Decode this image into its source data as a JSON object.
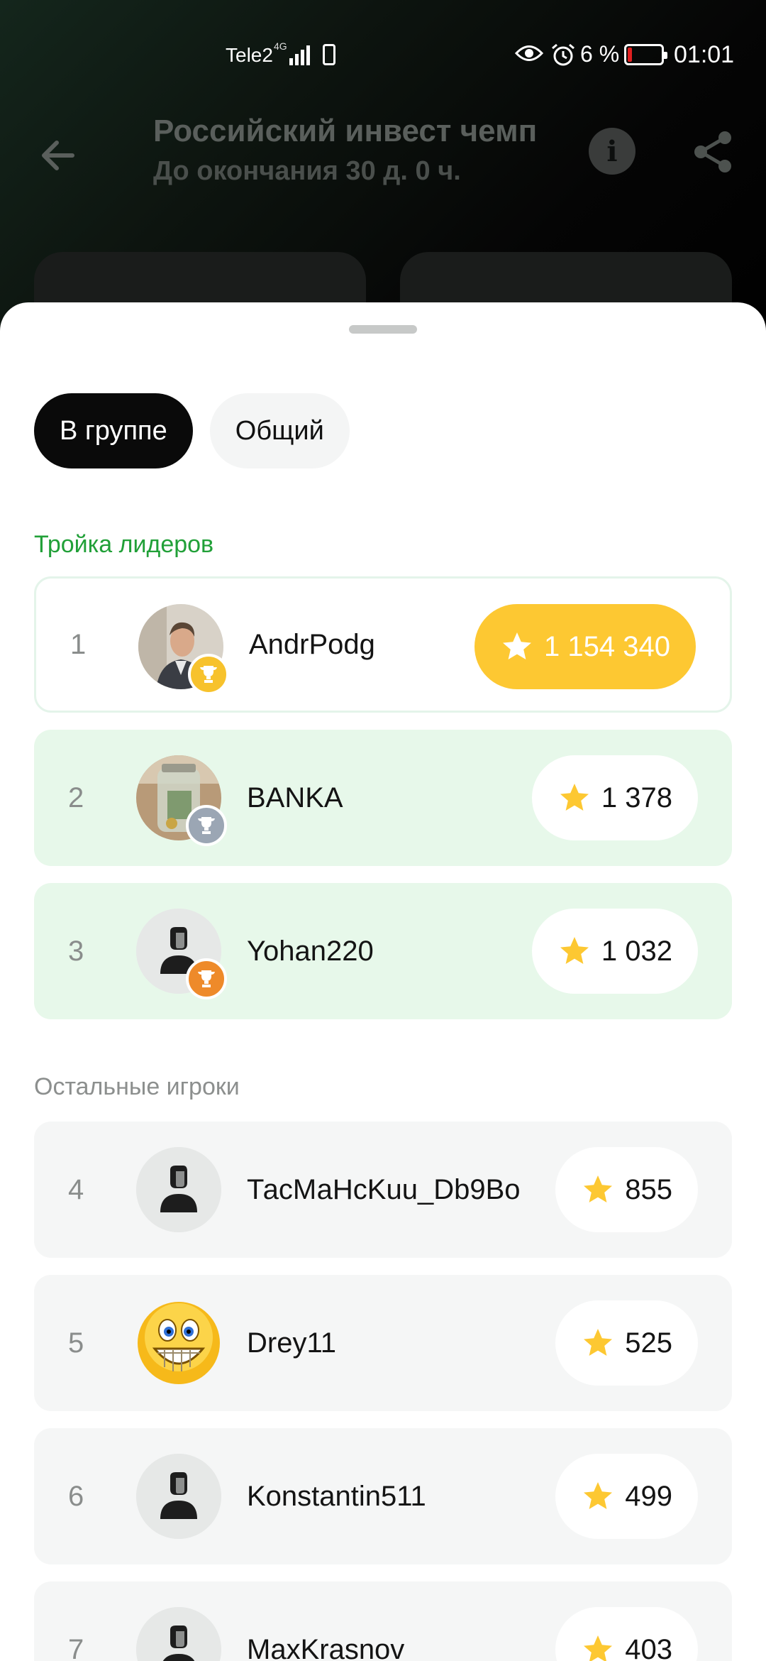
{
  "status_bar": {
    "carrier": "Tele2",
    "network": "4G",
    "battery_percent": "6 %",
    "time": "01:01",
    "icons": [
      "signal-icon",
      "phone-icon",
      "eye-icon",
      "alarm-icon",
      "battery-icon"
    ]
  },
  "header": {
    "title": "Российский инвест чемп",
    "subtitle": "До окончания 30 д. 0 ч.",
    "back_icon": "arrow-left-icon",
    "info_label": "i",
    "share_icon": "share-icon"
  },
  "tabs": [
    {
      "label": "В группе",
      "active": true
    },
    {
      "label": "Общий",
      "active": false
    }
  ],
  "leaders_label": "Тройка лидеров",
  "others_label": "Остальные игроки",
  "leaders": [
    {
      "rank": "1",
      "name": "AndrPodg",
      "score": "1 154 340",
      "badge": "gold-trophy-icon",
      "avatar": "photo-man-avatar"
    },
    {
      "rank": "2",
      "name": "BANKA",
      "score": "1 378",
      "badge": "silver-trophy-icon",
      "avatar": "photo-jar-avatar"
    },
    {
      "rank": "3",
      "name": "Yohan220",
      "score": "1 032",
      "badge": "bronze-trophy-icon",
      "avatar": "default-user-avatar"
    }
  ],
  "players": [
    {
      "rank": "4",
      "name": "ТасМаНсKuu_Db9Bo",
      "score": "855",
      "avatar": "default-user-avatar"
    },
    {
      "rank": "5",
      "name": "Drey11",
      "score": "525",
      "avatar": "smiley-avatar"
    },
    {
      "rank": "6",
      "name": "Konstantin511",
      "score": "499",
      "avatar": "default-user-avatar"
    },
    {
      "rank": "7",
      "name": "MaxKrasnov",
      "score": "403",
      "avatar": "default-user-avatar"
    }
  ],
  "colors": {
    "accent_green": "#21a038",
    "gold": "#fdc832",
    "leader_row": "#e7f8ea",
    "other_row": "#f5f6f6"
  }
}
